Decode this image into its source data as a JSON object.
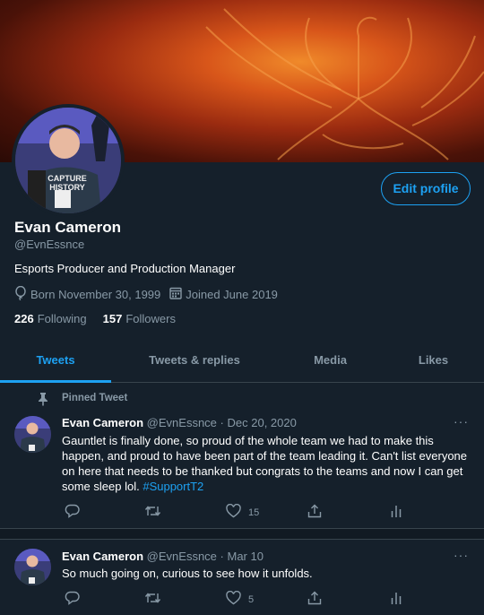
{
  "profile": {
    "name": "Evan Cameron",
    "handle": "@EvnEssnce",
    "bio": "Esports Producer and Production Manager",
    "born": "Born November 30, 1999",
    "joined": "Joined June 2019",
    "following_count": "226",
    "following_label": "Following",
    "followers_count": "157",
    "followers_label": "Followers",
    "edit_button": "Edit profile",
    "avatar_shirt_text": "CAPTURE HISTORY"
  },
  "tabs": [
    {
      "label": "Tweets",
      "active": true
    },
    {
      "label": "Tweets & replies",
      "active": false
    },
    {
      "label": "Media",
      "active": false
    },
    {
      "label": "Likes",
      "active": false
    }
  ],
  "tweets": [
    {
      "pinned_label": "Pinned Tweet",
      "author": "Evan Cameron",
      "handle": "@EvnEssnce",
      "sep": "·",
      "date": "Dec 20, 2020",
      "text": "Gauntlet is finally done, so proud of the whole team we had to make this happen, and proud to have been part of the team leading it. Can't list everyone on here that needs to be thanked but congrats to the teams and now I can get some sleep lol.",
      "hashtag": "#SupportT2",
      "likes": "15",
      "more": "···"
    },
    {
      "author": "Evan Cameron",
      "handle": "@EvnEssnce",
      "sep": "·",
      "date": "Mar 10",
      "text": "So much going on, curious to see how it unfolds.",
      "likes": "5",
      "more": "···"
    }
  ],
  "icons": {
    "reply": "reply-icon",
    "retweet": "retweet-icon",
    "like": "heart-icon",
    "share": "share-icon",
    "analytics": "analytics-icon",
    "pin": "pin-icon",
    "birthday": "balloon-icon",
    "calendar": "calendar-icon"
  },
  "colors": {
    "background": "#15202b",
    "accent": "#1da1f2",
    "muted": "#8899a6",
    "divider": "#38444d"
  }
}
